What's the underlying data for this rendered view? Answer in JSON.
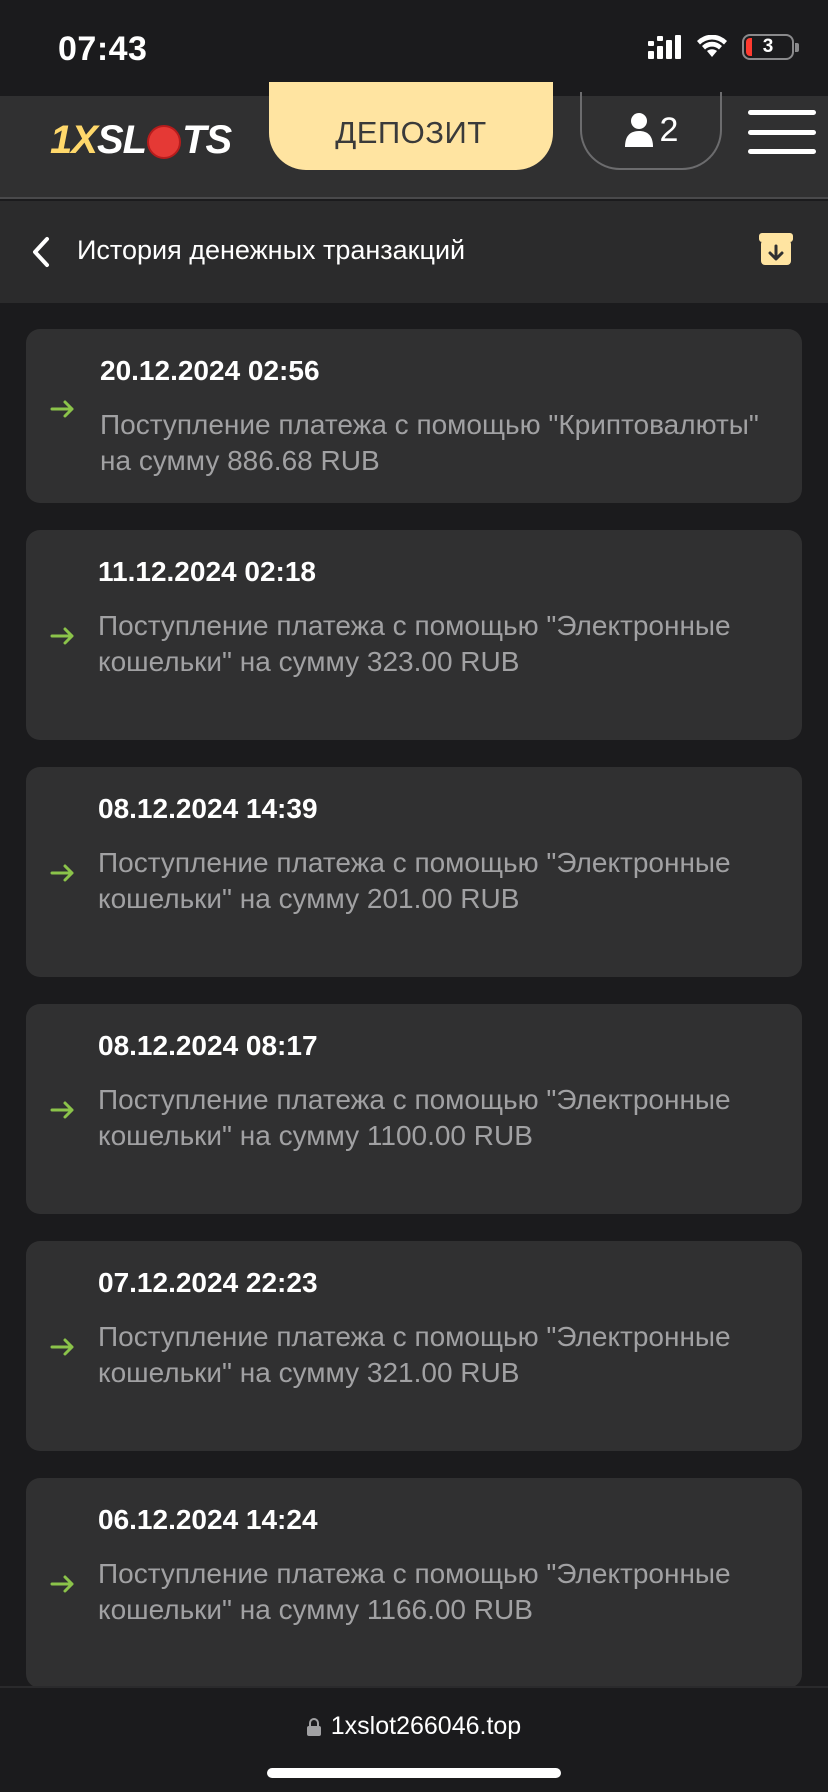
{
  "status_bar": {
    "time": "07:43",
    "battery_level": "3",
    "icons": [
      "signal-icon",
      "wifi-icon",
      "battery-icon"
    ]
  },
  "header": {
    "logo_prefix": "1X",
    "logo_suffix": "SL",
    "logo_end": "TS",
    "deposit_label": "ДЕПОЗИТ",
    "account_count": "2",
    "accent_color": "#ffe4a1"
  },
  "page": {
    "title": "История денежных транзакций"
  },
  "transactions": [
    {
      "date": "20.12.2024 02:56",
      "description": "Поступление платежа с помощью \"Криптовалюты\" на сумму 886.68 RUB"
    },
    {
      "date": "11.12.2024 02:18",
      "description": "Поступление платежа с помощью \"Электронные кошельки\" на сумму 323.00 RUB"
    },
    {
      "date": "08.12.2024 14:39",
      "description": "Поступление платежа с помощью \"Электронные кошельки\" на сумму 201.00 RUB"
    },
    {
      "date": "08.12.2024 08:17",
      "description": "Поступление платежа с помощью \"Электронные кошельки\" на сумму 1100.00 RUB"
    },
    {
      "date": "07.12.2024 22:23",
      "description": "Поступление платежа с помощью \"Электронные кошельки\" на сумму 321.00 RUB"
    },
    {
      "date": "06.12.2024 14:24",
      "description": "Поступление платежа с помощью \"Электронные кошельки\" на сумму 1166.00 RUB"
    }
  ],
  "browser": {
    "url": "1xslot266046.top"
  }
}
